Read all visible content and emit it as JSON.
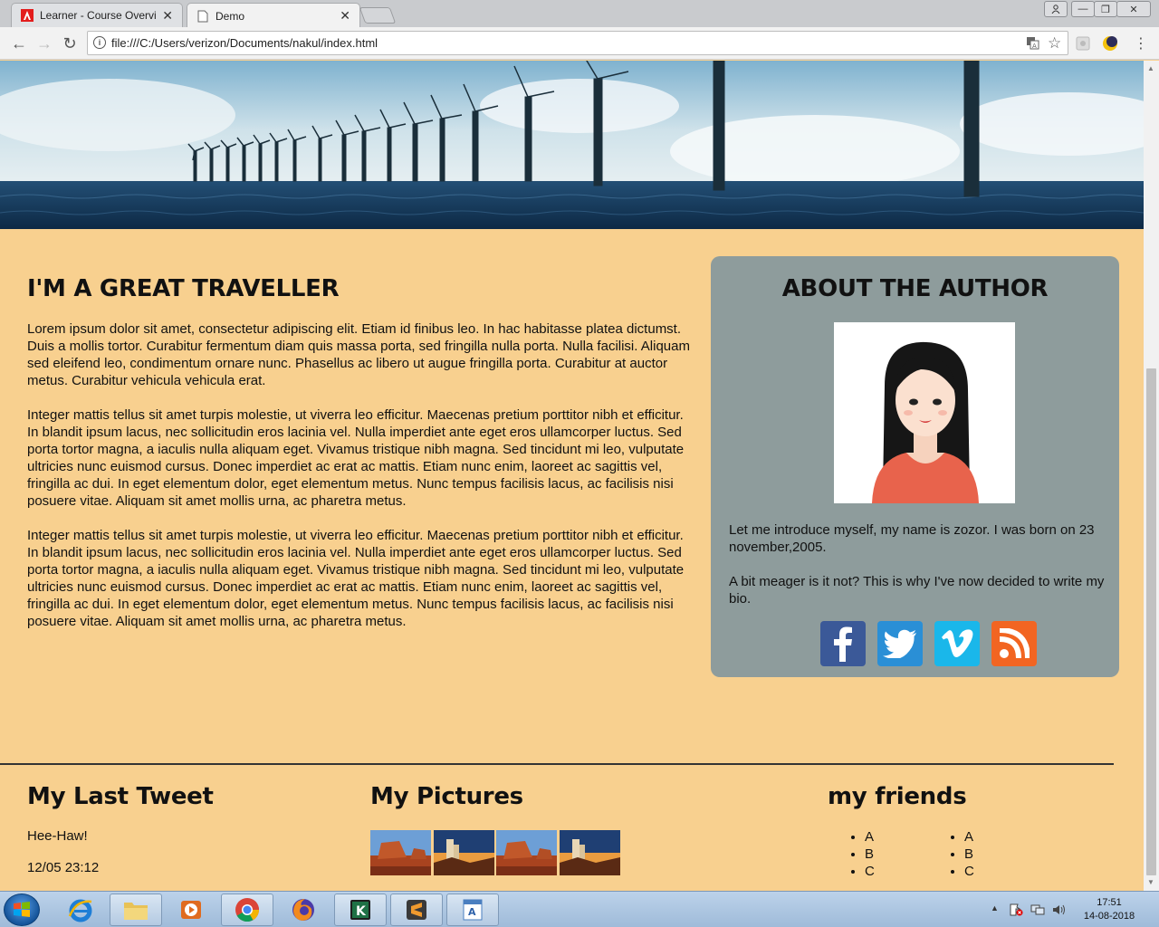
{
  "browser": {
    "tabs": [
      {
        "title": "Learner - Course Overview"
      },
      {
        "title": "Demo"
      }
    ],
    "address": "file:///C:/Users/verizon/Documents/nakul/index.html"
  },
  "article": {
    "title": "I'M A GREAT TRAVELLER",
    "paragraphs": [
      "Lorem ipsum dolor sit amet, consectetur adipiscing elit. Etiam id finibus leo. In hac habitasse platea dictumst. Duis a mollis tortor. Curabitur fermentum diam quis massa porta, sed fringilla nulla porta. Nulla facilisi. Aliquam sed eleifend leo, condimentum ornare nunc. Phasellus ac libero ut augue fringilla porta. Curabitur at auctor metus. Curabitur vehicula vehicula erat.",
      "Integer mattis tellus sit amet turpis molestie, ut viverra leo efficitur. Maecenas pretium porttitor nibh et efficitur. In blandit ipsum lacus, nec sollicitudin eros lacinia vel. Nulla imperdiet ante eget eros ullamcorper luctus. Sed porta tortor magna, a iaculis nulla aliquam eget. Vivamus tristique nibh magna. Sed tincidunt mi leo, vulputate ultricies nunc euismod cursus. Donec imperdiet ac erat ac mattis. Etiam nunc enim, laoreet ac sagittis vel, fringilla ac dui. In eget elementum dolor, eget elementum metus. Nunc tempus facilisis lacus, ac facilisis nisi posuere vitae. Aliquam sit amet mollis urna, ac pharetra metus.",
      "Integer mattis tellus sit amet turpis molestie, ut viverra leo efficitur. Maecenas pretium porttitor nibh et efficitur. In blandit ipsum lacus, nec sollicitudin eros lacinia vel. Nulla imperdiet ante eget eros ullamcorper luctus. Sed porta tortor magna, a iaculis nulla aliquam eget. Vivamus tristique nibh magna. Sed tincidunt mi leo, vulputate ultricies nunc euismod cursus. Donec imperdiet ac erat ac mattis. Etiam nunc enim, laoreet ac sagittis vel, fringilla ac dui. In eget elementum dolor, eget elementum metus. Nunc tempus facilisis lacus, ac facilisis nisi posuere vitae. Aliquam sit amet mollis urna, ac pharetra metus."
    ]
  },
  "aside": {
    "title": "ABOUT THE AUTHOR",
    "bio": [
      "Let me introduce myself, my name is zozor. I was born on 23 november,2005.",
      "A bit meager is it not? This is why I've now decided to write my bio."
    ],
    "social": [
      {
        "icon": "facebook-icon",
        "color": "#3b5998"
      },
      {
        "icon": "twitter-icon",
        "color": "#2a8fd6"
      },
      {
        "icon": "vimeo-icon",
        "color": "#1ab7ea"
      },
      {
        "icon": "rss-icon",
        "color": "#f26522"
      }
    ]
  },
  "footer": {
    "tweet": {
      "title": "My Last Tweet",
      "text": "Hee-Haw!",
      "time": "12/05 23:12"
    },
    "pictures": {
      "title": "My Pictures"
    },
    "friends": {
      "title": "my friends",
      "col1": [
        "A",
        "B",
        "C"
      ],
      "col2": [
        "A",
        "B",
        "C"
      ]
    }
  },
  "taskbar": {
    "time": "17:51",
    "date": "14-08-2018"
  },
  "colors": {
    "page_bg": "#f8d08f",
    "aside_bg": "#8e9c9c"
  }
}
